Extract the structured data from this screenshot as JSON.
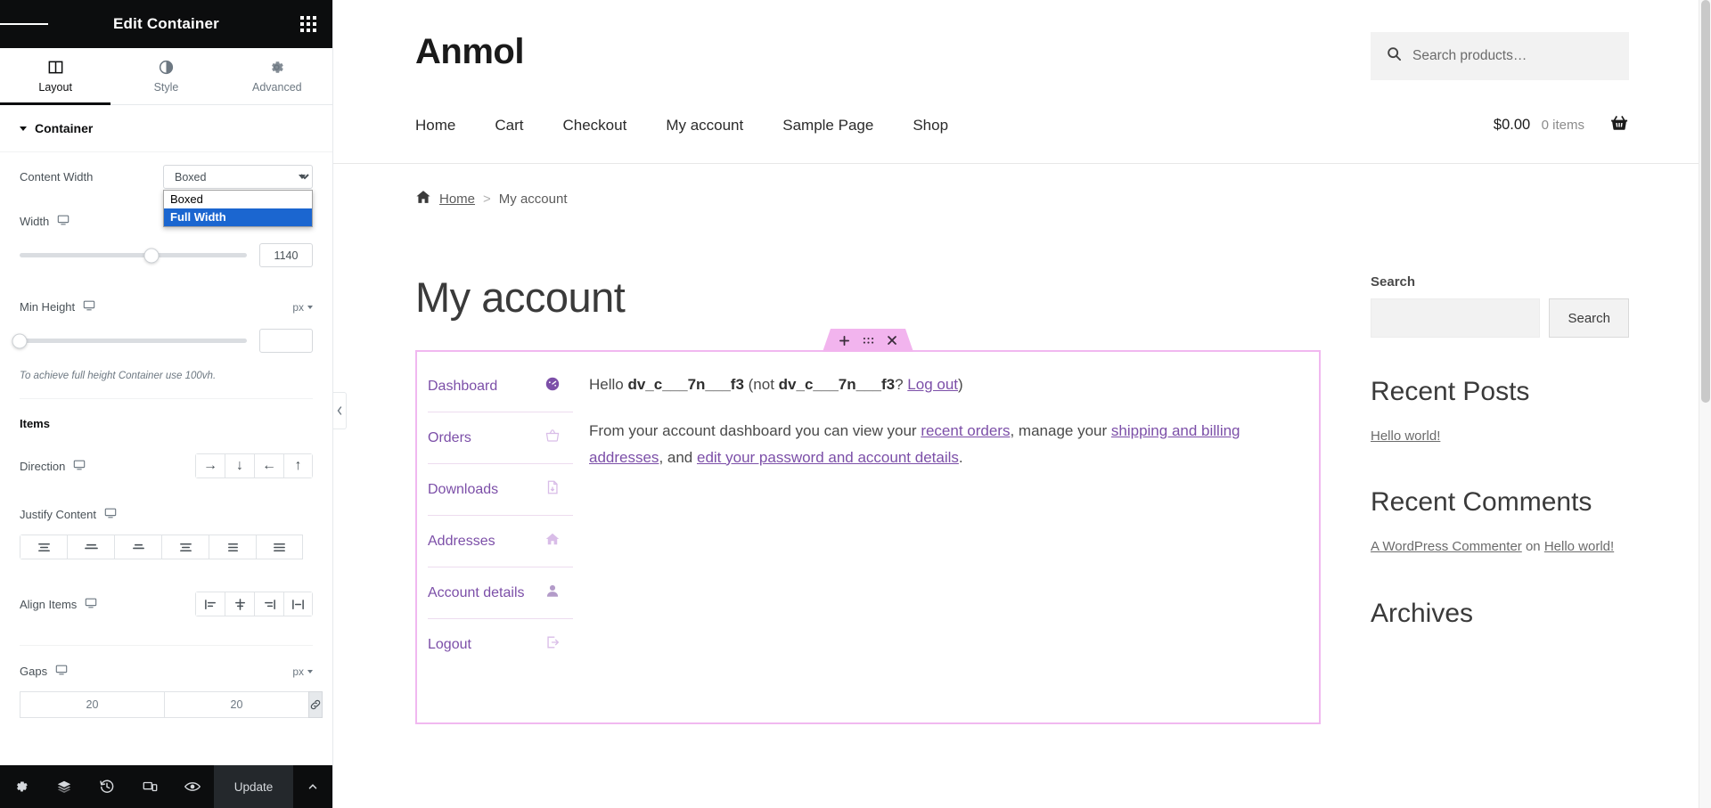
{
  "panel": {
    "title": "Edit Container",
    "menu_icon": "hamburger-icon",
    "widgets_icon": "grid-icon",
    "tabs": [
      {
        "label": "Layout",
        "icon": "columns-icon",
        "active": true
      },
      {
        "label": "Style",
        "icon": "contrast-icon",
        "active": false
      },
      {
        "label": "Advanced",
        "icon": "gear-icon",
        "active": false
      }
    ],
    "section": {
      "label": "Container",
      "expanded": true
    },
    "content_width": {
      "label": "Content Width",
      "value": "Boxed",
      "open": true,
      "options": [
        {
          "label": "Boxed",
          "selected": false
        },
        {
          "label": "Full Width",
          "selected": true
        }
      ]
    },
    "width": {
      "label": "Width",
      "device": "desktop-icon",
      "value": "1140",
      "slider_percent": 58
    },
    "min_height": {
      "label": "Min Height",
      "device": "desktop-icon",
      "unit": "px",
      "value": "",
      "slider_percent": 0
    },
    "hint": "To achieve full height Container use 100vh.",
    "items_group": "Items",
    "direction": {
      "label": "Direction",
      "device": "desktop-icon",
      "options": [
        "row",
        "column",
        "row-reverse",
        "column-reverse"
      ],
      "glyphs": [
        "→",
        "↓",
        "←",
        "↑"
      ]
    },
    "justify_content": {
      "label": "Justify Content",
      "device": "desktop-icon",
      "options": [
        "flex-start",
        "center",
        "flex-end",
        "space-between",
        "space-around",
        "space-evenly"
      ]
    },
    "align_items": {
      "label": "Align Items",
      "device": "desktop-icon",
      "options": [
        "flex-start",
        "center",
        "flex-end",
        "stretch"
      ]
    },
    "gaps": {
      "label": "Gaps",
      "device": "desktop-icon",
      "unit": "px",
      "column": "20",
      "row": "20",
      "link_icon": "link-icon"
    },
    "footer": {
      "settings_icon": "gear-icon",
      "navigator_icon": "layers-icon",
      "history_icon": "history-icon",
      "responsive_icon": "responsive-icon",
      "preview_icon": "eye-icon",
      "update_label": "Update",
      "chevron_icon": "chevron-up-icon"
    },
    "collapse_icon": "chevron-left-icon"
  },
  "site": {
    "title": "Anmol",
    "product_search_placeholder": "Search products…",
    "search_icon": "search-icon",
    "nav": [
      {
        "label": "Home"
      },
      {
        "label": "Cart"
      },
      {
        "label": "Checkout"
      },
      {
        "label": "My account"
      },
      {
        "label": "Sample Page"
      },
      {
        "label": "Shop"
      }
    ],
    "cart": {
      "amount": "$0.00",
      "items": "0 items",
      "icon": "basket-icon"
    },
    "breadcrumb": {
      "home_icon": "home-icon",
      "home": "Home",
      "separator": ">",
      "current": "My account"
    },
    "page_title": "My account",
    "elementor_handle": {
      "add_icon": "plus-icon",
      "drag_icon": "drag-dots-icon",
      "close_icon": "close-icon"
    },
    "account_nav": [
      {
        "label": "Dashboard",
        "icon": "dashboard-icon"
      },
      {
        "label": "Orders",
        "icon": "basket-icon"
      },
      {
        "label": "Downloads",
        "icon": "download-icon"
      },
      {
        "label": "Addresses",
        "icon": "home-icon"
      },
      {
        "label": "Account details",
        "icon": "user-icon"
      },
      {
        "label": "Logout",
        "icon": "logout-icon"
      }
    ],
    "account_body": {
      "greeting_pre": "Hello ",
      "username": "dv_c___7n___f3",
      "greeting_mid": " (not ",
      "username2": "dv_c___7n___f3",
      "greeting_q": "? ",
      "logout_link": "Log out",
      "greeting_end": ")",
      "desc_1": "From your account dashboard you can view your ",
      "link_orders": "recent orders",
      "desc_2": ", manage your ",
      "link_addresses": "shipping and billing addresses",
      "desc_3": ", and ",
      "link_details": "edit your password and account details",
      "desc_4": "."
    },
    "sidebar": {
      "search_label": "Search",
      "search_value": "",
      "search_button": "Search",
      "recent_posts_title": "Recent Posts",
      "recent_posts": [
        {
          "label": "Hello world!"
        }
      ],
      "recent_comments_title": "Recent Comments",
      "recent_comments": [
        {
          "author": "A WordPress Commenter",
          "on": " on ",
          "post": "Hello world!"
        }
      ],
      "archives_title": "Archives"
    }
  },
  "colors": {
    "panel_dark": "#0c0d0e",
    "dropdown_highlight": "#1b66d0",
    "elementor_handle": "#f2b4ee",
    "account_border": "#f1b8f0",
    "account_link": "#7c4fa8"
  }
}
